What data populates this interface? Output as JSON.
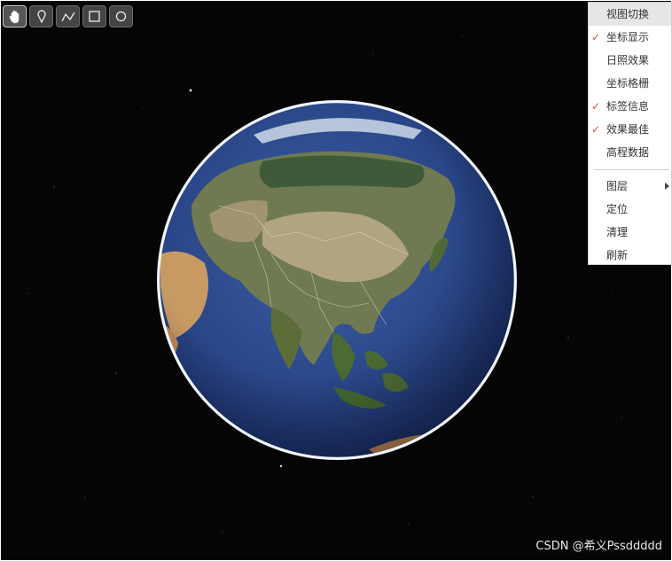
{
  "toolbar": {
    "tools": [
      {
        "icon": "hand-pan-icon",
        "active": true
      },
      {
        "icon": "map-pin-icon",
        "active": false
      },
      {
        "icon": "polyline-icon",
        "active": false
      },
      {
        "icon": "rectangle-icon",
        "active": false
      },
      {
        "icon": "circle-icon",
        "active": false
      }
    ]
  },
  "context_menu": {
    "items": [
      {
        "label": "视图切换",
        "checked": false,
        "highlighted": true
      },
      {
        "label": "坐标显示",
        "checked": true
      },
      {
        "label": "日照效果",
        "checked": false
      },
      {
        "label": "坐标格栅",
        "checked": false
      },
      {
        "label": "标签信息",
        "checked": true
      },
      {
        "label": "效果最佳",
        "checked": true
      },
      {
        "label": "高程数据",
        "checked": false
      }
    ],
    "secondary_items": [
      {
        "label": "图层",
        "has_submenu": true
      },
      {
        "label": "定位"
      },
      {
        "label": "清理"
      },
      {
        "label": "刷新"
      }
    ],
    "check_glyph": "✓",
    "check_color": "#e64545"
  },
  "watermark": "CSDN @希义Pssddddd",
  "colors": {
    "space_background": "#050505",
    "ocean": "#2f4f93",
    "atmosphere_rim": "#dfe9ff"
  }
}
